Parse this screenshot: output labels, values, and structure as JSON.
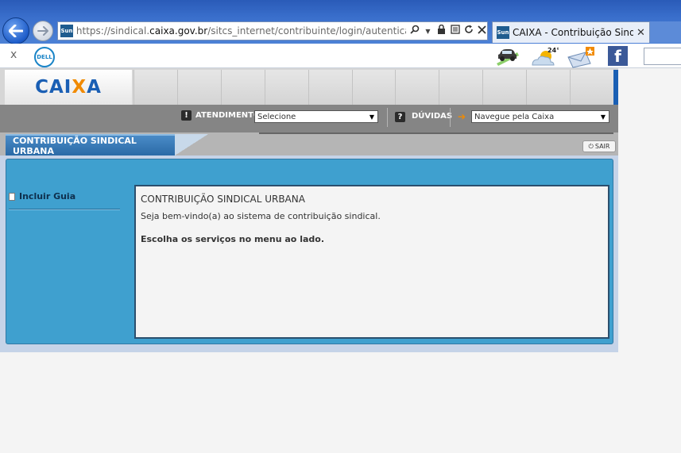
{
  "browser": {
    "url_prefix": "https://sindical.",
    "url_domain": "caixa.gov.br",
    "url_path": "/sitcs_internet/contribuinte/login/autenticar.do;jses",
    "site_favicon_text": "Sun",
    "tab_title": "CAIXA - Contribuição Sindi...",
    "tab_favicon_text": "Sun",
    "tab_close_glyph": "✕",
    "toolbar_close_glyph": "x",
    "dell_text": "DELL",
    "weather_temp": "24°",
    "facebook_glyph": "f"
  },
  "header": {
    "logo_pre": "CAI",
    "logo_x": "X",
    "logo_post": "A"
  },
  "nav": {
    "atendimento_label": "ATENDIMENTO",
    "atendimento_select": "Selecione",
    "duvidas_label": "DÚVIDAS",
    "navegue_select": "Navegue pela Caixa"
  },
  "section": {
    "tab_label": "CONTRIBUIÇÃO SINDICAL URBANA",
    "sair_label": "SAIR"
  },
  "sidebar": {
    "items": [
      {
        "label": "Incluir Guia"
      }
    ]
  },
  "content": {
    "title": "CONTRIBUIÇÃO SINDICAL URBANA",
    "welcome": "Seja bem-vindo(a) ao sistema de contribuição sindical.",
    "instruction": "Escolha os serviços no menu ao lado."
  },
  "colors": {
    "brand_blue": "#1a5fb4",
    "brand_orange": "#f18a00",
    "panel_blue": "#3fa0cf"
  }
}
